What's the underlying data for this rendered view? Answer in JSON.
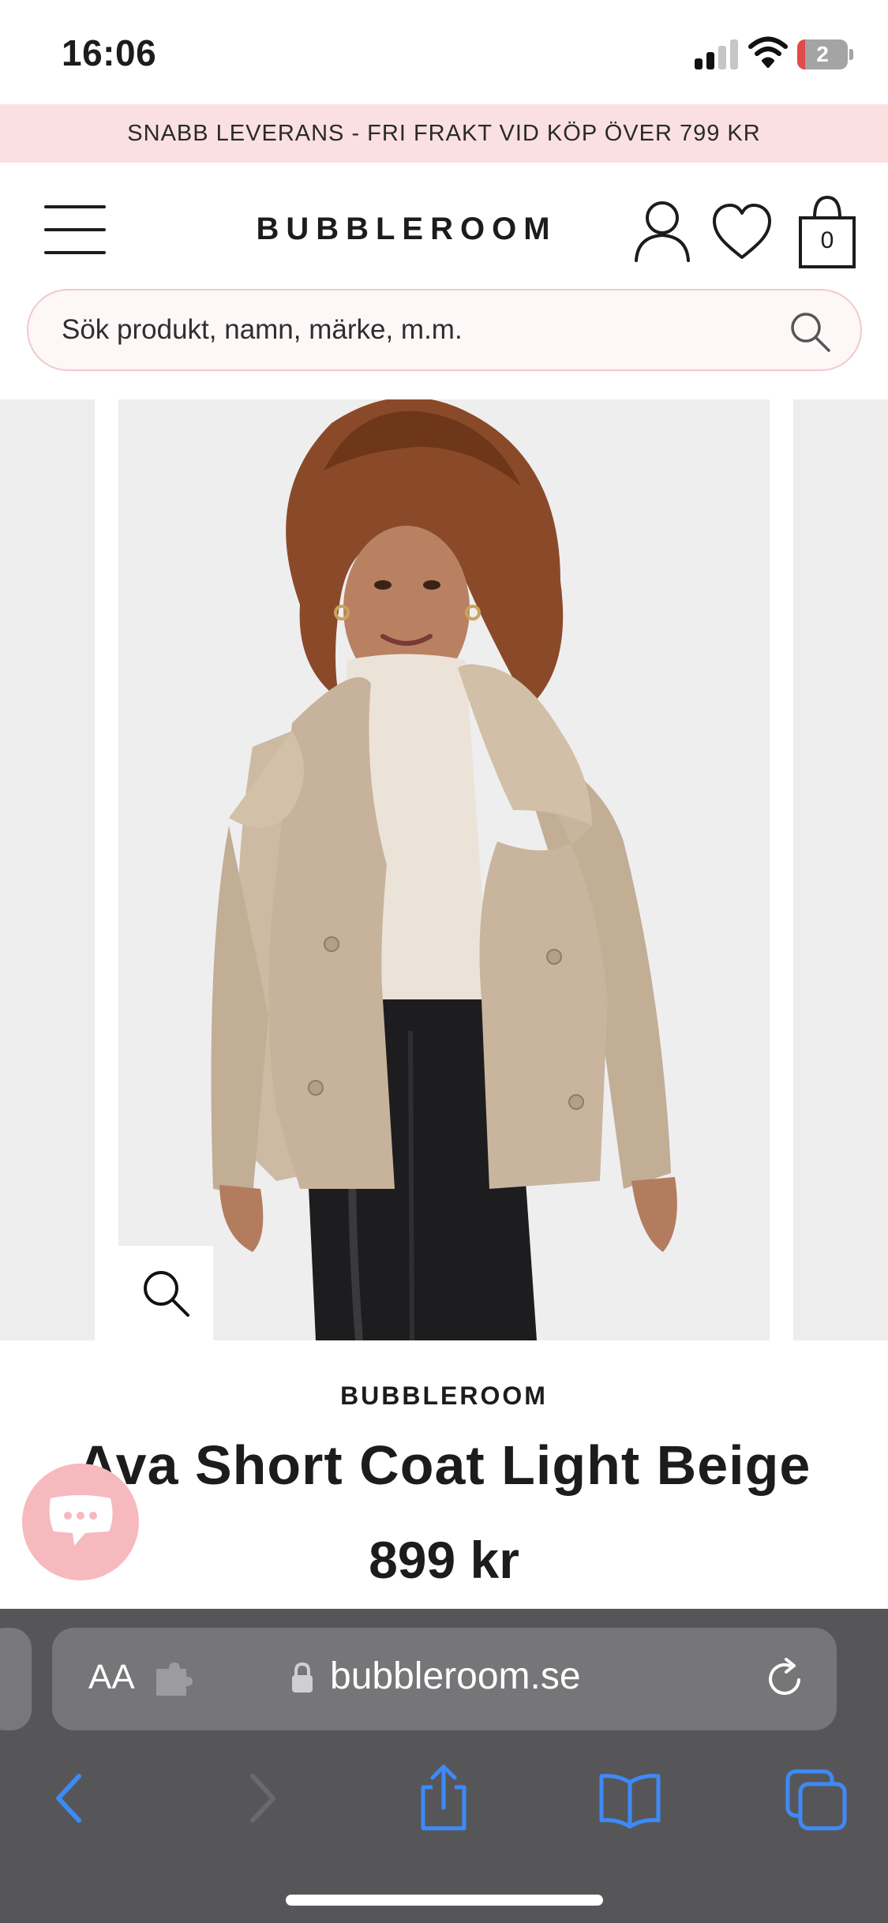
{
  "status_bar": {
    "time": "16:06",
    "battery_level": "2",
    "icons": [
      "cellular-signal-icon",
      "wifi-icon",
      "battery-icon"
    ]
  },
  "promo": {
    "text": "SNABB LEVERANS - FRI FRAKT VID KÖP ÖVER 799 KR",
    "background": "#fbe0e2"
  },
  "header": {
    "brand": "BUBBLEROOM",
    "icons": [
      "menu-icon",
      "account-icon",
      "heart-icon",
      "bag-icon"
    ],
    "bag_count": "0"
  },
  "search": {
    "placeholder": "Sök produkt, namn, märke, m.m."
  },
  "gallery": {
    "image": "woman-wearing-beige-short-coat",
    "zoom_icon": "zoom-icon"
  },
  "product": {
    "brand": "BUBBLEROOM",
    "title": "Ava Short Coat Light Beige",
    "price": "899 kr"
  },
  "chat": {
    "icon": "chat-icon",
    "color": "#f6b9be"
  },
  "browser": {
    "text_size_label": "AA",
    "url": "bubbleroom.se",
    "nav": [
      "back-icon",
      "forward-icon",
      "share-icon",
      "bookmarks-icon",
      "tabs-icon"
    ],
    "accent": "#3d8af7"
  }
}
